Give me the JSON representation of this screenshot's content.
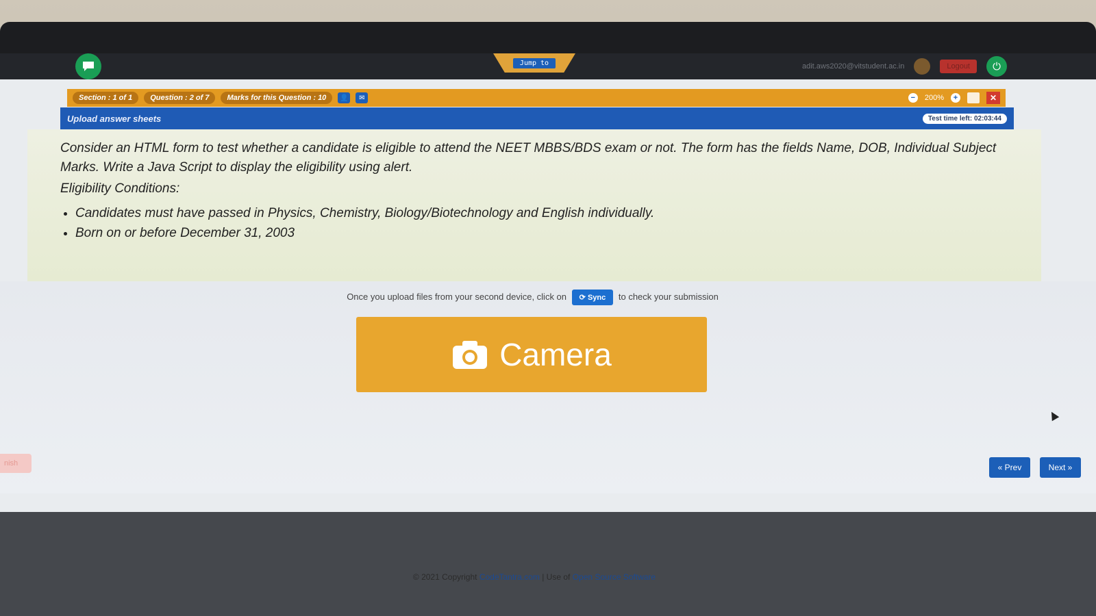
{
  "topbar": {
    "user_email": "adit.aws2020@vitstudent.ac.in",
    "logout_label": "Logout",
    "jump_label": "Jump to"
  },
  "sectionbar": {
    "section": "Section : 1 of 1",
    "question": "Question : 2 of 7",
    "marks": "Marks for this Question : 10",
    "zoom": "200%"
  },
  "header": {
    "title": "Upload answer sheets",
    "timer": "Test time left: 02:03:44"
  },
  "question": {
    "text": "Consider an HTML form to test whether a candidate is eligible to attend the NEET MBBS/BDS exam or not. The form has the fields Name, DOB, Individual Subject Marks. Write a Java Script to display the eligibility using alert.",
    "subheading": "Eligibility Conditions:",
    "conditions": [
      "Candidates must have passed in Physics, Chemistry, Biology/Biotechnology and English individually.",
      "Born on or before December 31, 2003"
    ]
  },
  "upload": {
    "sync_prefix": "Once you upload files from your second device, click on",
    "sync_button": "Sync",
    "sync_suffix": "to check your submission",
    "camera_label": "Camera"
  },
  "nav": {
    "prev_label": "« Prev",
    "next_label": "Next »",
    "finish_label": "nish"
  },
  "footer": {
    "copyright": "© 2021 Copyright",
    "site_link": "CodeTantra.com",
    "separator": "| Use of",
    "oss_link": "Open Source Software"
  },
  "colors": {
    "accent_orange": "#e39a21",
    "primary_blue": "#1f5bb5",
    "camera_orange": "#e8a62e",
    "success_green": "#1a9e55",
    "danger_red": "#d33a2f"
  }
}
